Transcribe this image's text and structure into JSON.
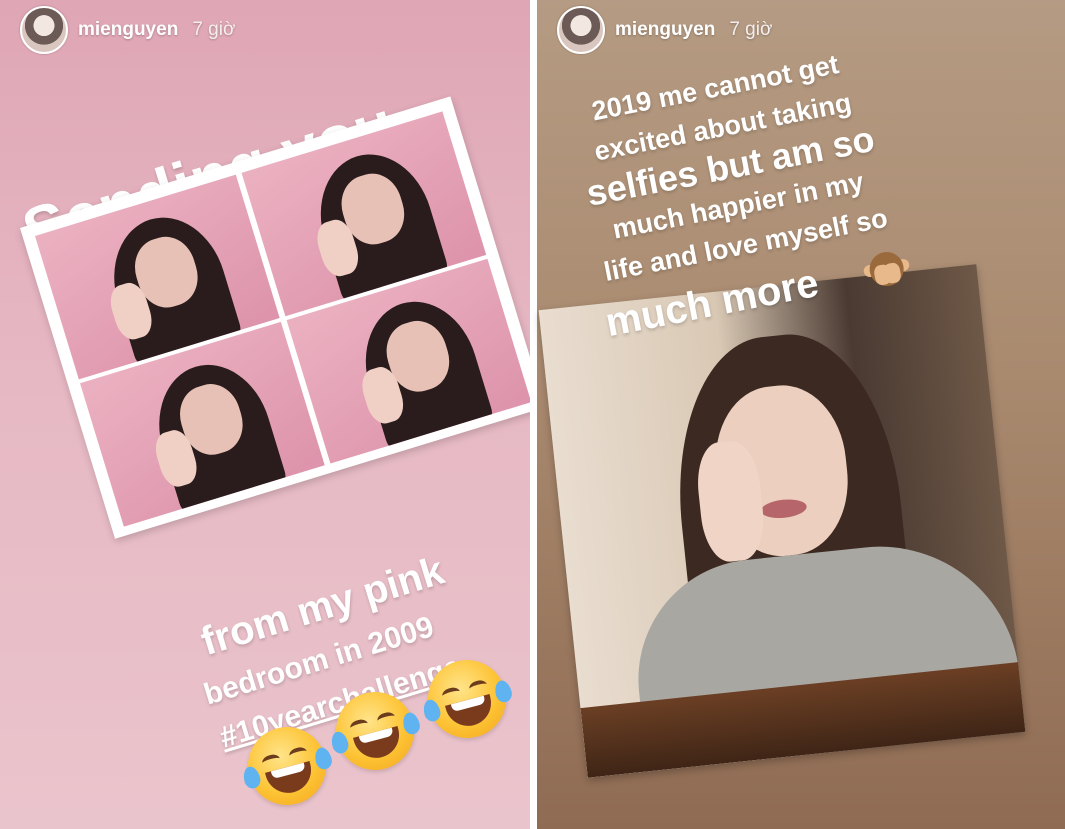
{
  "left_story": {
    "user": {
      "username": "mienguyen",
      "time": "7 giờ"
    },
    "caption_top": "Sending you",
    "caption_bottom": {
      "line1": "from my pink",
      "line2": "bedroom in 2009",
      "hashtag": "#10yearchallenge"
    },
    "collage": {
      "photos": [
        "photo-1",
        "photo-2",
        "photo-3",
        "photo-4"
      ]
    },
    "emojis": [
      "face-with-tears-of-joy",
      "face-with-tears-of-joy",
      "face-with-tears-of-joy"
    ]
  },
  "right_story": {
    "user": {
      "username": "mienguyen",
      "time": "7 giờ"
    },
    "caption_lines": [
      "2019 me cannot get",
      "excited about taking",
      "selfies but am so",
      "much happier in my",
      "life and love myself so"
    ],
    "caption_last": "much more",
    "emoji": "see-no-evil-monkey"
  },
  "colors": {
    "left_bg": "#dfa6b5",
    "right_bg": "#a98a6f",
    "text": "#ffffff"
  }
}
